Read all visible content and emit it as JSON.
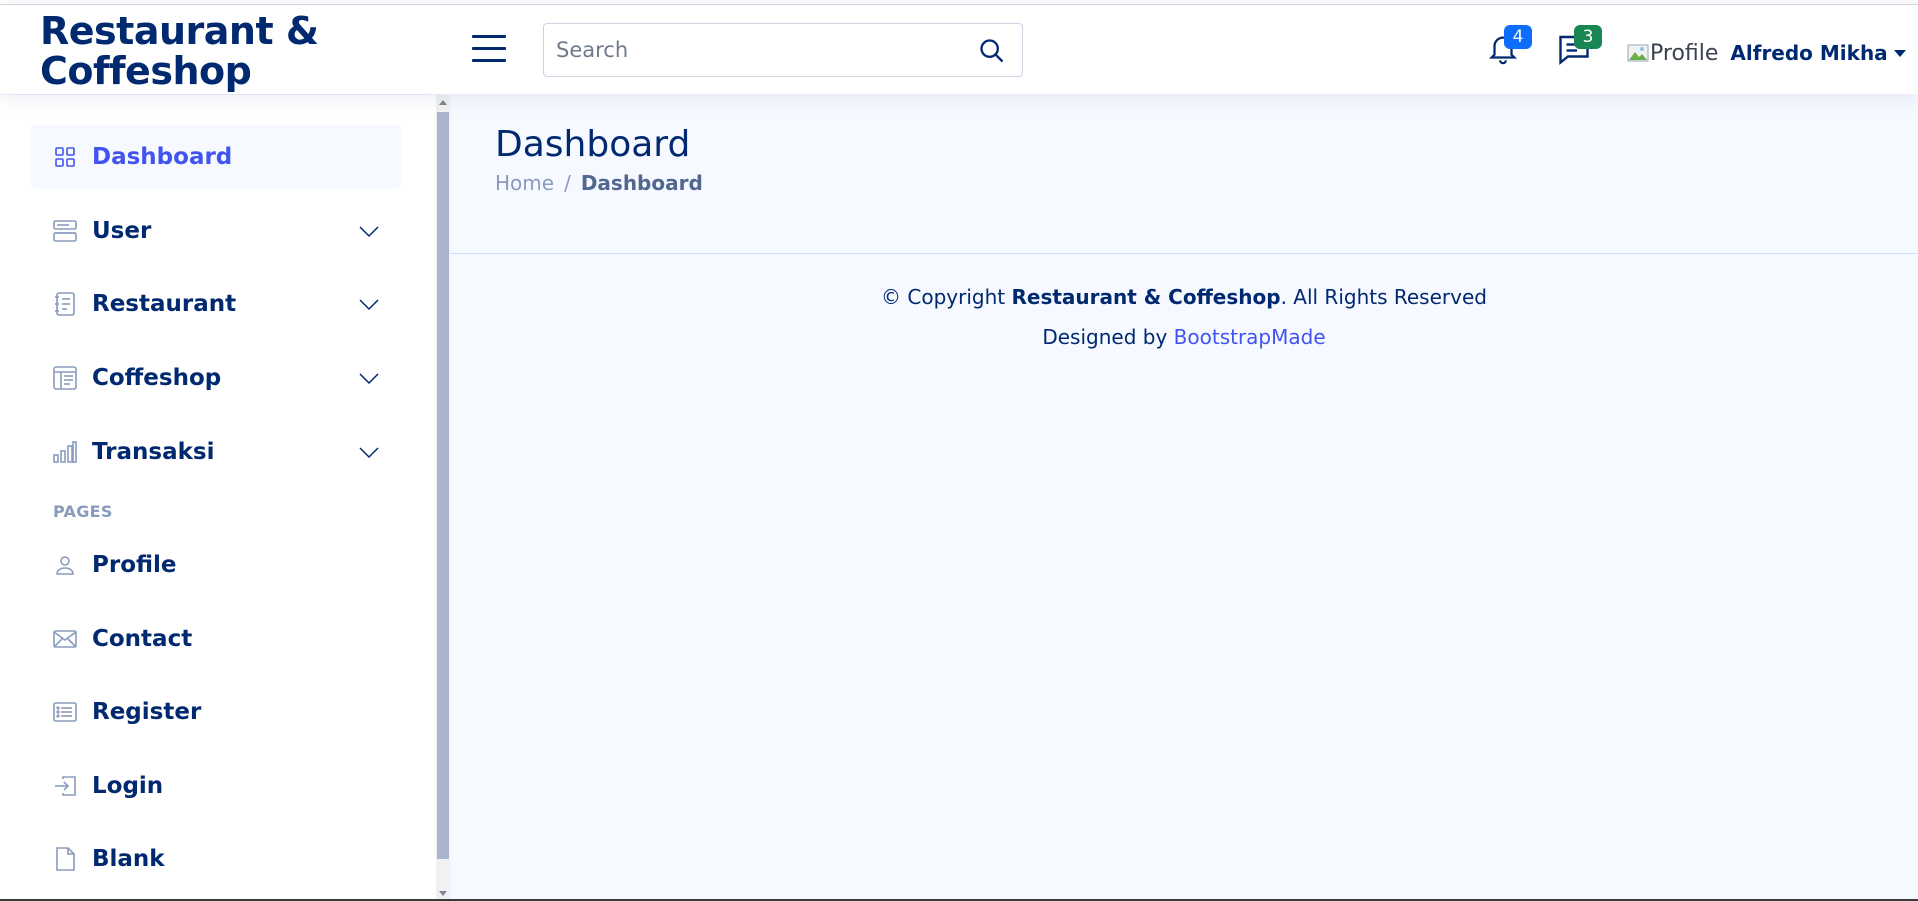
{
  "header": {
    "brand_line1": "Restaurant &",
    "brand_line2": "Coffeshop",
    "search_placeholder": "Search",
    "notifications_count": "4",
    "messages_count": "3",
    "profile_alt": "Profile",
    "profile_name": "Alfredo Mikha"
  },
  "sidebar": {
    "items": [
      {
        "label": "Dashboard",
        "icon": "grid-icon",
        "active": true
      },
      {
        "label": "User",
        "icon": "menu-button-icon",
        "chevron": true
      },
      {
        "label": "Restaurant",
        "icon": "journal-text-icon",
        "chevron": true
      },
      {
        "label": "Coffeshop",
        "icon": "layout-text-window-icon",
        "chevron": true
      },
      {
        "label": "Transaksi",
        "icon": "bar-chart-icon",
        "chevron": true
      }
    ],
    "pages_heading": "PAGES",
    "pages": [
      {
        "label": "Profile",
        "icon": "person-icon"
      },
      {
        "label": "Contact",
        "icon": "envelope-icon"
      },
      {
        "label": "Register",
        "icon": "card-list-icon"
      },
      {
        "label": "Login",
        "icon": "box-arrow-in-right-icon"
      },
      {
        "label": "Blank",
        "icon": "file-earmark-icon"
      }
    ]
  },
  "main": {
    "title": "Dashboard",
    "breadcrumb_home": "Home",
    "breadcrumb_sep": "/",
    "breadcrumb_current": "Dashboard"
  },
  "footer": {
    "copyright_prefix": "© Copyright ",
    "copyright_brand": "Restaurant & Coffeshop",
    "copyright_suffix": ". All Rights Reserved",
    "designed_by": "Designed by ",
    "designer_link": "BootstrapMade"
  },
  "colors": {
    "primary": "#4154f1",
    "navy": "#012970",
    "notification_badge": "#0d6efd",
    "message_badge": "#198754",
    "background": "#f6f9ff"
  }
}
